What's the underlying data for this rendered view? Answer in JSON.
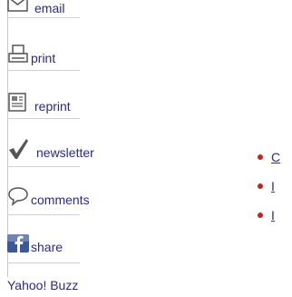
{
  "tools": {
    "email": {
      "label": "email",
      "icon": "envelope-icon"
    },
    "print": {
      "label": "print",
      "icon": "printer-icon"
    },
    "reprint": {
      "label": "reprint",
      "icon": "document-icon"
    },
    "newsletter": {
      "label": "newsletter",
      "icon": "checkmark-icon"
    },
    "comments": {
      "label": "comments",
      "icon": "speech-bubble-icon"
    },
    "share": {
      "label": "share",
      "icon": "facebook-icon"
    }
  },
  "yahoo_buzz": {
    "label": "Yahoo! Buzz"
  },
  "bullets": [
    {
      "text": "C"
    },
    {
      "text": "I"
    },
    {
      "text": "I"
    }
  ],
  "colors": {
    "link": "#2a2a8a",
    "bullet": "#cc2020",
    "rule": "#c8c8c8",
    "facebook": "#3b5998"
  }
}
